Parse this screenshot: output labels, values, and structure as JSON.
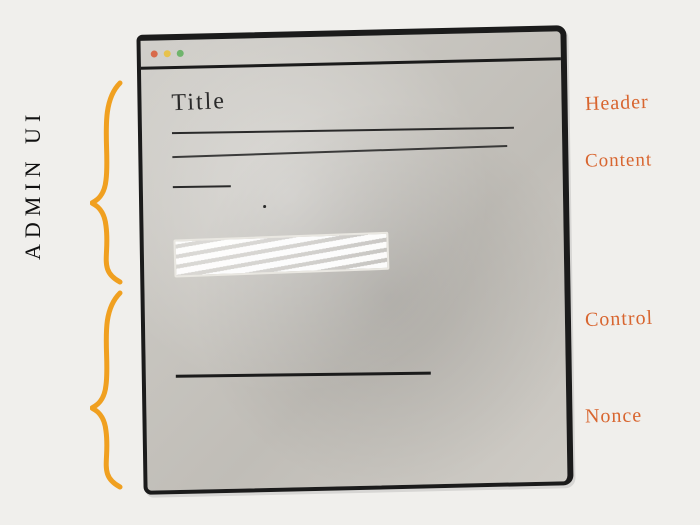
{
  "window": {
    "traffic_lights": [
      "close",
      "minimize",
      "zoom"
    ]
  },
  "form": {
    "title_placeholder": "Title",
    "control_value": "",
    "button_label": "",
    "nonce_value": ""
  },
  "annotations": {
    "left_label": "ADMIN  UI",
    "right": {
      "header": "Header",
      "content": "Content",
      "control": "Control",
      "nonce": "Nonce"
    }
  }
}
